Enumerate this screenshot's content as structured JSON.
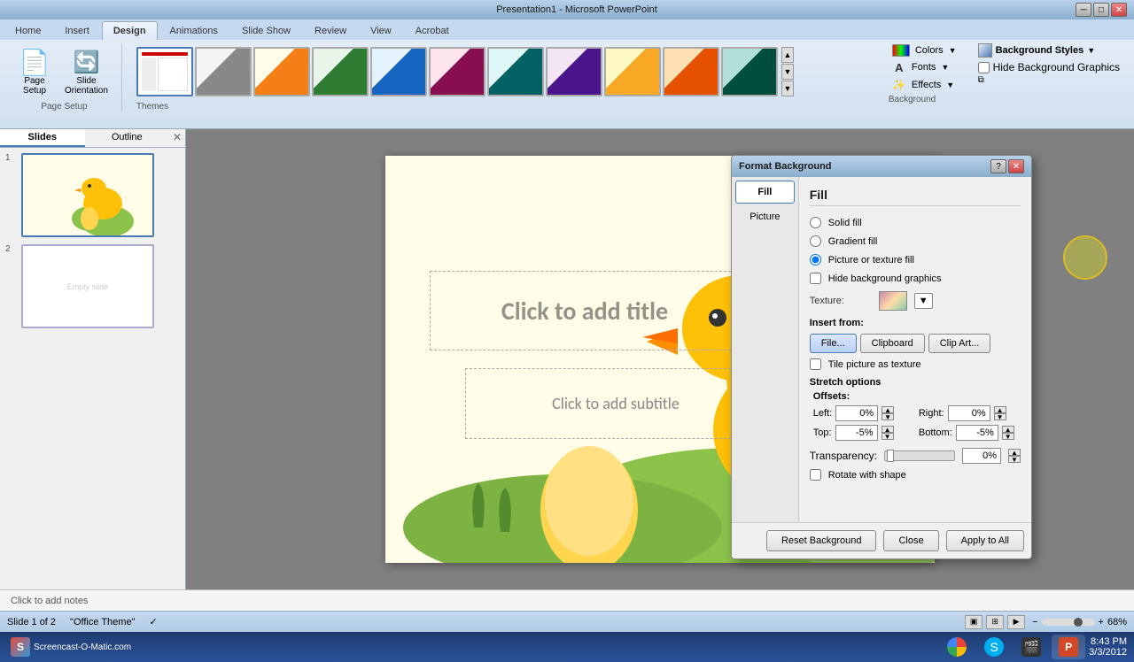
{
  "window": {
    "title": "Presentation1 - Microsoft PowerPoint",
    "controls": [
      "minimize",
      "maximize",
      "close"
    ]
  },
  "ribbon": {
    "tabs": [
      "Home",
      "Insert",
      "Design",
      "Animations",
      "Slide Show",
      "Review",
      "View",
      "Acrobat"
    ],
    "active_tab": "Design",
    "groups": {
      "page_setup": {
        "label": "Page Setup",
        "buttons": [
          "Page Setup",
          "Slide Orientation"
        ]
      },
      "themes": {
        "label": "Themes"
      },
      "background": {
        "label": "Background",
        "colors_btn": "Colors",
        "fonts_btn": "Fonts",
        "effects_btn": "Effects",
        "bg_styles_btn": "Background Styles",
        "hide_bg_checkbox": "Hide Background Graphics",
        "launcher_tooltip": "Format Background"
      }
    }
  },
  "slides_panel": {
    "tabs": [
      "Slides",
      "Outline"
    ],
    "active_tab": "Slides",
    "slides": [
      {
        "num": 1,
        "selected": true
      },
      {
        "num": 2,
        "selected": false
      }
    ]
  },
  "slide": {
    "title_placeholder": "Click to add title",
    "subtitle_placeholder": "Click to add subtitle"
  },
  "notes": {
    "placeholder": "Click to add notes"
  },
  "statusbar": {
    "slide_info": "Slide 1 of 2",
    "theme": "\"Office Theme\"",
    "zoom": "68%"
  },
  "dialog": {
    "title": "Format Background",
    "nav": [
      "Fill",
      "Picture"
    ],
    "active_nav": "Fill",
    "fill_section": {
      "title": "Fill",
      "options": [
        {
          "label": "Solid fill",
          "selected": false
        },
        {
          "label": "Gradient fill",
          "selected": false
        },
        {
          "label": "Picture or texture fill",
          "selected": true
        }
      ],
      "hide_bg_label": "Hide background graphics",
      "texture_label": "Texture:",
      "insert_from_label": "Insert from:",
      "insert_buttons": [
        "File...",
        "Clipboard",
        "Clip Art..."
      ],
      "tile_label": "Tile picture as texture",
      "stretch_label": "Stretch options",
      "offsets_label": "Offsets:",
      "left_label": "Left:",
      "left_val": "0%",
      "right_label": "Right:",
      "right_val": "0%",
      "top_label": "Top:",
      "top_val": "-5%",
      "bottom_label": "Bottom:",
      "bottom_val": "-5%",
      "transparency_label": "Transparency:",
      "transparency_val": "0%",
      "rotate_label": "Rotate with shape"
    },
    "footer_buttons": [
      "Reset Background",
      "Close",
      "Apply to All"
    ]
  },
  "taskbar": {
    "start_label": "Screencast-O-Matic.com",
    "clock": "8:43 PM\n3/3/2012",
    "apps": [
      "chrome",
      "skype",
      "film",
      "powerpoint"
    ]
  }
}
